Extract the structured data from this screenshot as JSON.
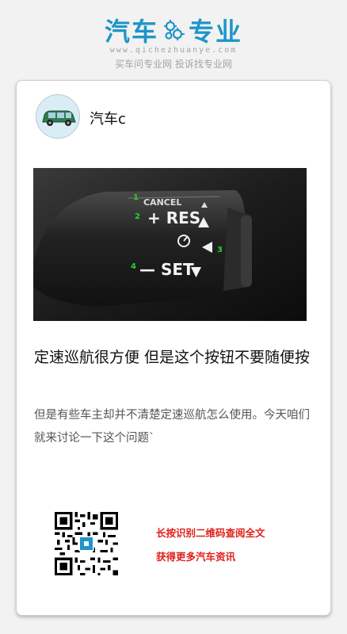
{
  "header": {
    "brand_left": "汽车",
    "brand_right": "专业",
    "domain": "www.qichezhuanye.com",
    "slogan": "买车问专业网 投诉找专业网",
    "brand_color": "#1f95c9"
  },
  "article": {
    "author": "汽车c",
    "title": "定速巡航很方便 但是这个按钮不要随便按",
    "summary": "但是有些车主却并不清楚定速巡航怎么使用。今天咱们就来讨论一下这个问题`",
    "image_labels": {
      "cancel": "CANCEL",
      "res": "+ RES",
      "set": "— SET",
      "num1": "1",
      "num2": "2",
      "num3": "3",
      "num4": "4"
    }
  },
  "promo": {
    "line1": "长按识别二维码查阅全文",
    "line2": "获得更多汽车资讯",
    "color": "#e0201a"
  },
  "icons": {
    "logo_gear": "gear-icon",
    "avatar": "car-avatar-icon",
    "qr": "qr-code-icon"
  }
}
